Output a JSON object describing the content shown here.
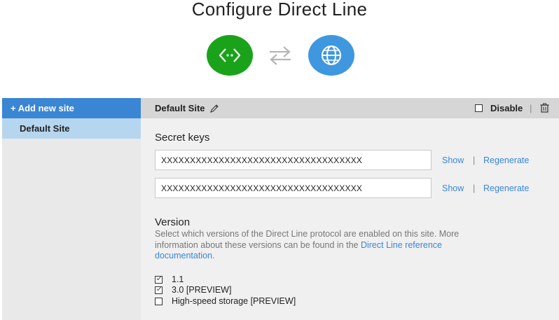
{
  "page": {
    "title": "Configure Direct Line"
  },
  "icons": {
    "left_circle": "code-brackets-icon",
    "swap": "swap-arrows-icon",
    "right_circle": "globe-icon",
    "green": "#1aa31a",
    "blue": "#3f97e0"
  },
  "sidebar": {
    "add_label": "+ Add new site",
    "items": [
      {
        "label": "Default Site"
      }
    ]
  },
  "header": {
    "site_name": "Default Site",
    "disable_label": "Disable",
    "separator": "|"
  },
  "secret_keys": {
    "title": "Secret keys",
    "keys": [
      {
        "value": "XXXXXXXXXXXXXXXXXXXXXXXXXXXXXXXXXXX",
        "show_label": "Show",
        "separator": "|",
        "regenerate_label": "Regenerate"
      },
      {
        "value": "XXXXXXXXXXXXXXXXXXXXXXXXXXXXXXXXXXX",
        "show_label": "Show",
        "separator": "|",
        "regenerate_label": "Regenerate"
      }
    ]
  },
  "version": {
    "title": "Version",
    "description_prefix": "Select which versions of the Direct Line protocol are enabled on this site. More information about these versions can be found in the ",
    "doc_link": "Direct Line reference documentation",
    "description_suffix": ".",
    "options": [
      {
        "label": "1.1",
        "checked": true
      },
      {
        "label": "3.0 [PREVIEW]",
        "checked": true
      },
      {
        "label": "High-speed storage [PREVIEW]",
        "checked": false
      }
    ]
  },
  "colors": {
    "accent": "#3a86d4",
    "selected": "#b6d6ef"
  }
}
